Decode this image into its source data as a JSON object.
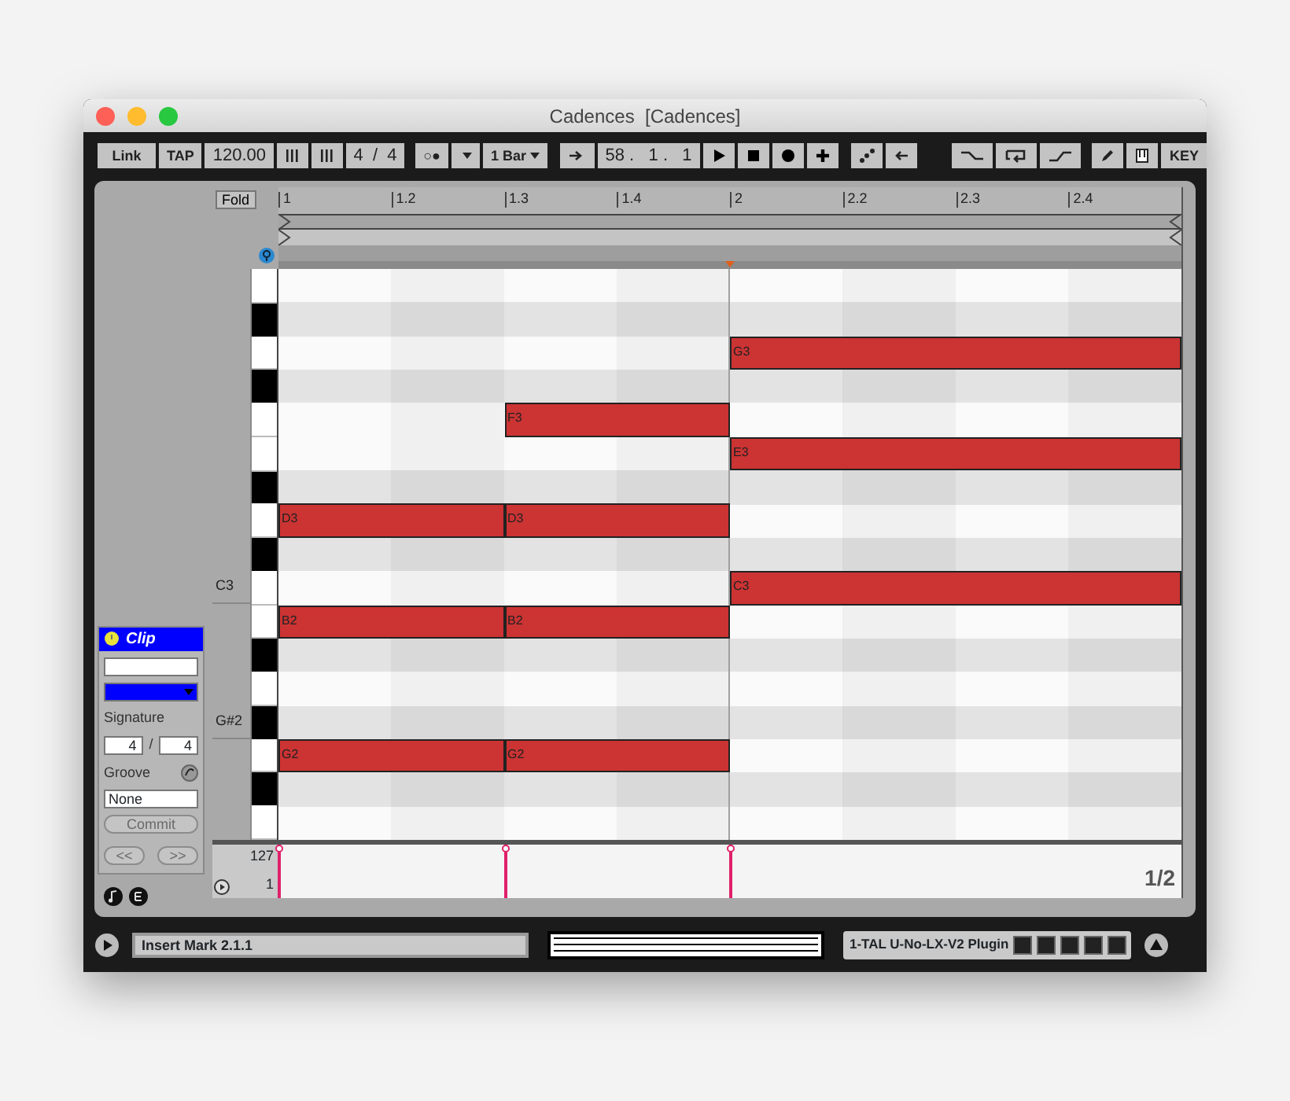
{
  "window": {
    "title": "Cadences  [Cadences]"
  },
  "toolbar": {
    "link": "Link",
    "tap": "TAP",
    "tempo": "120.00",
    "signature": "4  /  4",
    "metronome": "○●",
    "quantize": "1 Bar",
    "position": "58 .   1 .   1",
    "key": "KEY"
  },
  "clip": {
    "title": "Clip",
    "signature_label": "Signature",
    "numerator": "4",
    "separator": "/",
    "denominator": "4",
    "groove_label": "Groove",
    "groove": "None",
    "commit": "Commit",
    "commit_disabled": true,
    "previous": "<<",
    "next": ">>",
    "nav_disabled": true
  },
  "editor": {
    "fold": "Fold",
    "ruler": [
      "1",
      "1.2",
      "1.3",
      "1.4",
      "2",
      "2.2",
      "2.3",
      "2.4"
    ],
    "rows": [
      {
        "kind": "white"
      },
      {
        "kind": "black"
      },
      {
        "kind": "white",
        "notes": [
          {
            "label": "G3"
          }
        ]
      },
      {
        "kind": "black"
      },
      {
        "kind": "white",
        "notes": [
          {
            "label": "F3"
          }
        ]
      },
      {
        "kind": "white",
        "notes": [
          {
            "label": "E3"
          }
        ]
      },
      {
        "kind": "black"
      },
      {
        "kind": "white",
        "notes": [
          {
            "label": "D3"
          },
          {
            "label": "D3"
          }
        ]
      },
      {
        "kind": "black"
      },
      {
        "kind": "white",
        "label": "C3",
        "notes": [
          {
            "label": "C3"
          }
        ]
      },
      {
        "kind": "white",
        "notes": [
          {
            "label": "B2"
          },
          {
            "label": "B2"
          }
        ]
      },
      {
        "kind": "black"
      },
      {
        "kind": "white"
      },
      {
        "kind": "black",
        "label": "G#2"
      },
      {
        "kind": "white",
        "notes": [
          {
            "label": "G2"
          },
          {
            "label": "G2"
          }
        ]
      },
      {
        "kind": "black"
      },
      {
        "kind": "white"
      }
    ],
    "velocity": {
      "max": "127",
      "min": "1",
      "stems": [
        {
          "level": 1
        },
        {
          "level": 1
        },
        {
          "level": 1
        }
      ]
    },
    "page": "1/2"
  },
  "status_bar": {
    "text": "Insert Mark 2.1.1",
    "device": "1-TAL U-No-LX-V2 Plugin"
  }
}
